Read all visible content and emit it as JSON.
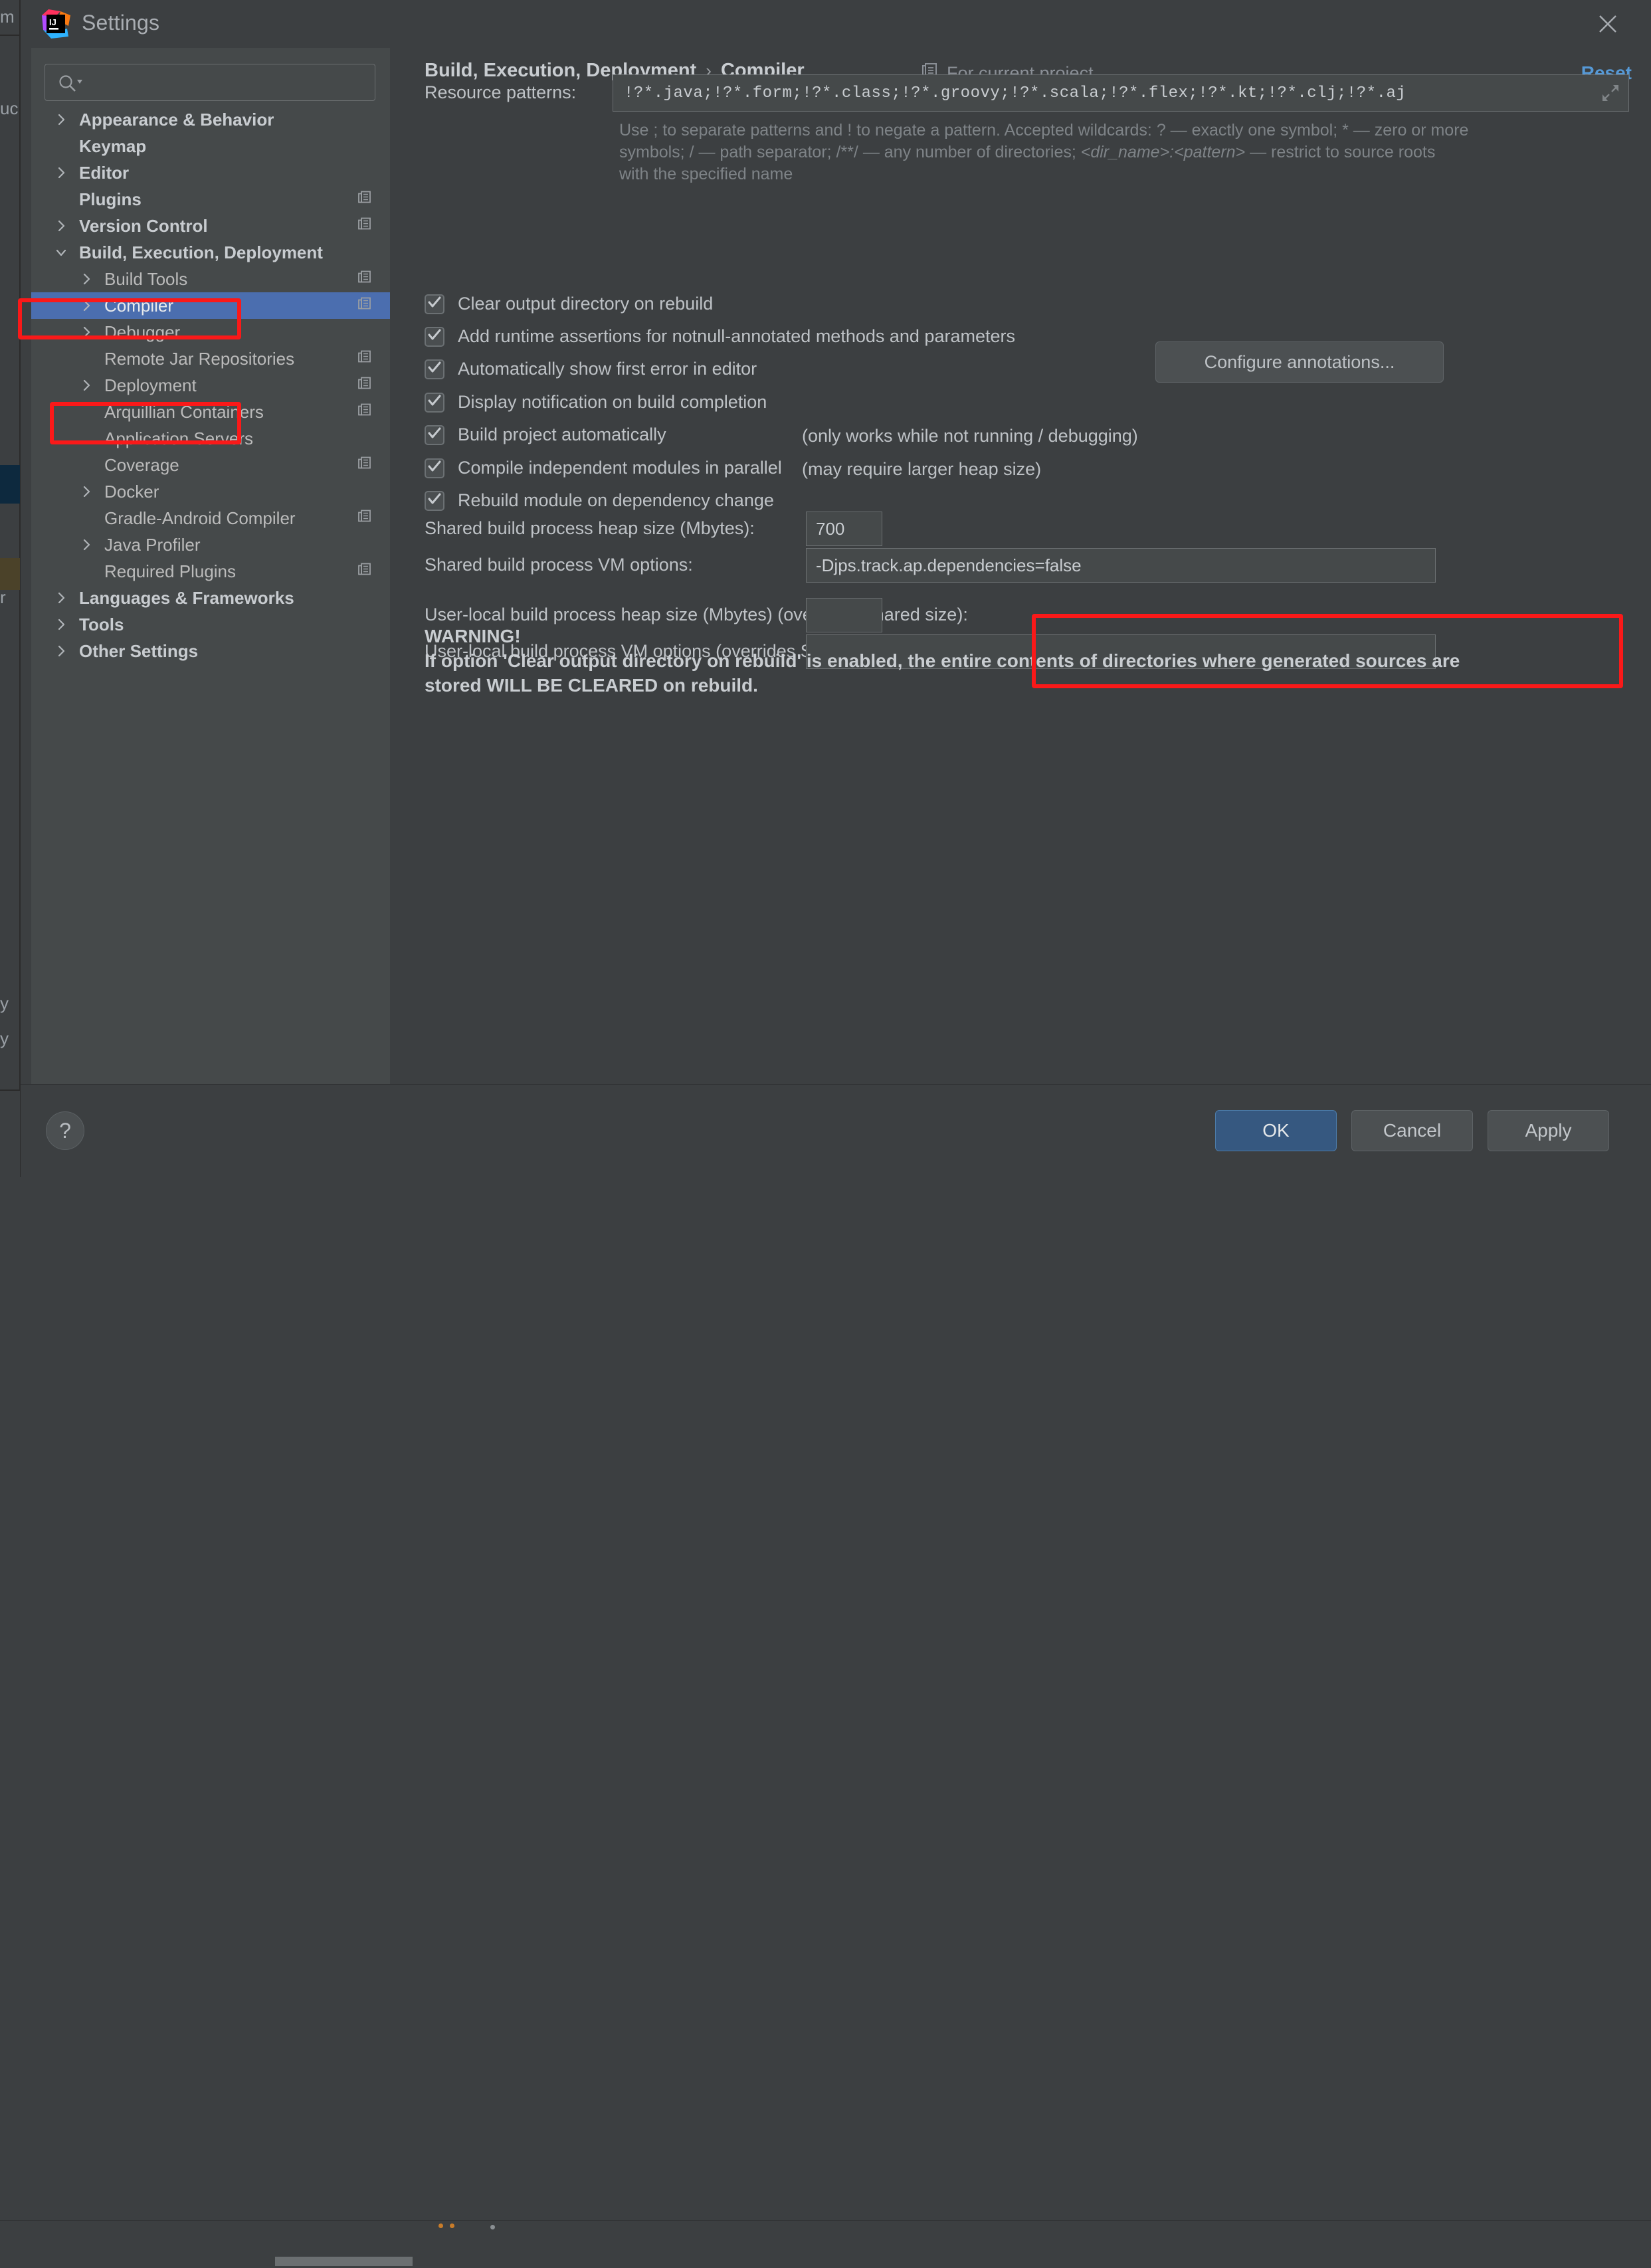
{
  "window": {
    "title": "Settings",
    "logo_icon": "intellij-idea-logo",
    "close_icon": "close-icon"
  },
  "sidebar": {
    "search": {
      "placeholder": "",
      "value": "",
      "icon": "search-icon"
    },
    "items": [
      {
        "label": "Appearance & Behavior",
        "indent": 0,
        "arrow": "chevron-right",
        "bold": true,
        "copy": false,
        "selected": false
      },
      {
        "label": "Keymap",
        "indent": 0,
        "arrow": "none",
        "bold": true,
        "copy": false,
        "selected": false
      },
      {
        "label": "Editor",
        "indent": 0,
        "arrow": "chevron-right",
        "bold": true,
        "copy": false,
        "selected": false
      },
      {
        "label": "Plugins",
        "indent": 0,
        "arrow": "none",
        "bold": true,
        "copy": true,
        "selected": false
      },
      {
        "label": "Version Control",
        "indent": 0,
        "arrow": "chevron-right",
        "bold": true,
        "copy": true,
        "selected": false
      },
      {
        "label": "Build, Execution, Deployment",
        "indent": 0,
        "arrow": "chevron-down",
        "bold": true,
        "copy": false,
        "selected": false
      },
      {
        "label": "Build Tools",
        "indent": 1,
        "arrow": "chevron-right",
        "bold": false,
        "copy": true,
        "selected": false
      },
      {
        "label": "Compiler",
        "indent": 1,
        "arrow": "chevron-right",
        "bold": false,
        "copy": true,
        "selected": true
      },
      {
        "label": "Debugger",
        "indent": 1,
        "arrow": "chevron-right",
        "bold": false,
        "copy": false,
        "selected": false
      },
      {
        "label": "Remote Jar Repositories",
        "indent": 1,
        "arrow": "none",
        "bold": false,
        "copy": true,
        "selected": false
      },
      {
        "label": "Deployment",
        "indent": 1,
        "arrow": "chevron-right",
        "bold": false,
        "copy": true,
        "selected": false
      },
      {
        "label": "Arquillian Containers",
        "indent": 1,
        "arrow": "none",
        "bold": false,
        "copy": true,
        "selected": false
      },
      {
        "label": "Application Servers",
        "indent": 1,
        "arrow": "none",
        "bold": false,
        "copy": false,
        "selected": false
      },
      {
        "label": "Coverage",
        "indent": 1,
        "arrow": "none",
        "bold": false,
        "copy": true,
        "selected": false
      },
      {
        "label": "Docker",
        "indent": 1,
        "arrow": "chevron-right",
        "bold": false,
        "copy": false,
        "selected": false
      },
      {
        "label": "Gradle-Android Compiler",
        "indent": 1,
        "arrow": "none",
        "bold": false,
        "copy": true,
        "selected": false
      },
      {
        "label": "Java Profiler",
        "indent": 1,
        "arrow": "chevron-right",
        "bold": false,
        "copy": false,
        "selected": false
      },
      {
        "label": "Required Plugins",
        "indent": 1,
        "arrow": "none",
        "bold": false,
        "copy": true,
        "selected": false
      },
      {
        "label": "Languages & Frameworks",
        "indent": 0,
        "arrow": "chevron-right",
        "bold": true,
        "copy": false,
        "selected": false
      },
      {
        "label": "Tools",
        "indent": 0,
        "arrow": "chevron-right",
        "bold": true,
        "copy": false,
        "selected": false
      },
      {
        "label": "Other Settings",
        "indent": 0,
        "arrow": "chevron-right",
        "bold": true,
        "copy": false,
        "selected": false
      }
    ]
  },
  "header": {
    "breadcrumb_parent": "Build, Execution, Deployment",
    "breadcrumb_sep": "›",
    "breadcrumb_current": "Compiler",
    "scope_icon": "project-scope-icon",
    "scope_label": "For current project",
    "reset_label": "Reset"
  },
  "main": {
    "resource_patterns": {
      "label": "Resource patterns:",
      "value": "!?*.java;!?*.form;!?*.class;!?*.groovy;!?*.scala;!?*.flex;!?*.kt;!?*.clj;!?*.aj",
      "expand_icon": "expand-icon",
      "hint_line1": "Use ; to separate patterns and ! to negate a pattern. Accepted wildcards: ? — exactly one symbol; * — zero or more",
      "hint_line2_a": "symbols; / — path separator; /**/ — any number of directories; ",
      "hint_line2_italic": "<dir_name>:<pattern>",
      "hint_line2_b": " — restrict to source roots",
      "hint_line3": "with the specified name"
    },
    "checkboxes": [
      {
        "label": "Clear output directory on rebuild",
        "checked": true,
        "note": ""
      },
      {
        "label": "Add runtime assertions for notnull-annotated methods and parameters",
        "checked": true,
        "note": ""
      },
      {
        "label": "Automatically show first error in editor",
        "checked": true,
        "note": ""
      },
      {
        "label": "Display notification on build completion",
        "checked": true,
        "note": ""
      },
      {
        "label": "Build project automatically",
        "checked": true,
        "note": "(only works while not running / debugging)"
      },
      {
        "label": "Compile independent modules in parallel",
        "checked": true,
        "note": "(may require larger heap size)"
      },
      {
        "label": "Rebuild module on dependency change",
        "checked": true,
        "note": ""
      }
    ],
    "configure_annotations_label": "Configure annotations...",
    "fields": [
      {
        "label": "Shared build process heap size (Mbytes):",
        "value": "700"
      },
      {
        "label": "Shared build process VM options:",
        "value": "-Djps.track.ap.dependencies=false"
      },
      {
        "label": "User-local build process heap size (Mbytes) (overrides Shared size):",
        "value": ""
      },
      {
        "label": "User-local build process VM options (overrides Shared options):",
        "value": ""
      }
    ],
    "warning": {
      "title": "WARNING!",
      "line1": "If option 'Clear output directory on rebuild' is enabled, the entire contents of directories where generated sources are",
      "line2": "stored WILL BE CLEARED on rebuild."
    }
  },
  "footer": {
    "help_label": "?",
    "ok_label": "OK",
    "cancel_label": "Cancel",
    "apply_label": "Apply"
  },
  "annotations": {
    "accent_red": "#fa1919",
    "selection_blue": "#4b6eaf",
    "link_blue": "#5699d6"
  }
}
